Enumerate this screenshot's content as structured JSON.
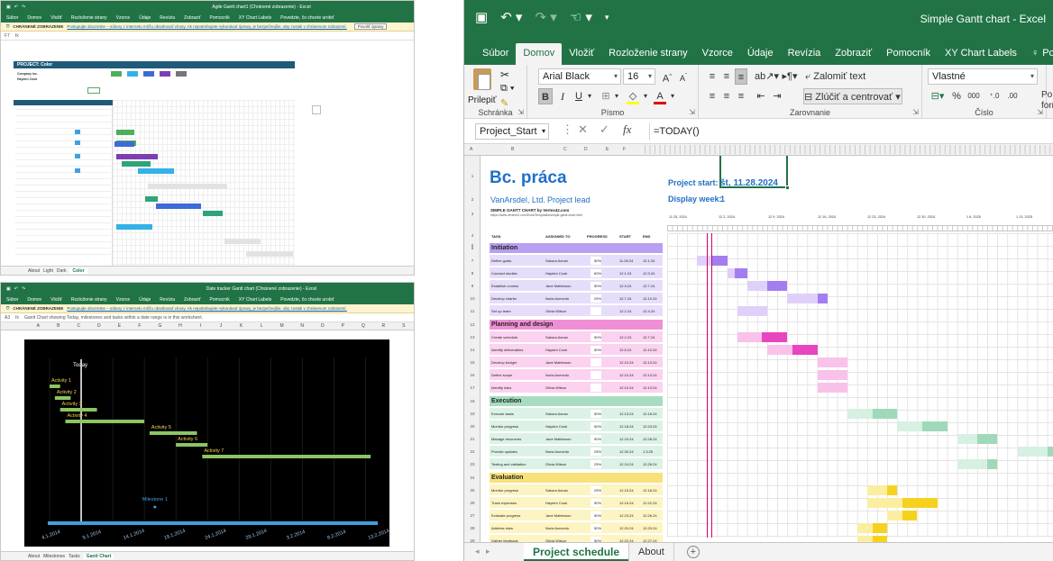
{
  "left_top": {
    "title": "Agile Gantt chart1 (Chránené zobrazenie) - Excel",
    "menu": [
      "Súbor",
      "Domov",
      "Vložiť",
      "Rozloženie strany",
      "Vzorce",
      "Údaje",
      "Revízia",
      "Zobraziť",
      "Pomocník",
      "XY Chart Labels",
      "Povedzte, čo chcete urobiť"
    ],
    "warning_title": "CHRÁNENÉ ZOBRAZENIE",
    "warning_text": "Postupujte obozretne – súbory z internetu môžu obsahovať vírusy. Ak nepotrebujete vykonávať úpravy, je bezpečnejšie, aby zostali v chránenom zobrazení.",
    "warning_button": "Povoliť úpravy",
    "cell_ref": "F7",
    "header": "PROJECT: Color",
    "sub1": "Company Inc.",
    "sub2": "Hayden Cook",
    "tabs": [
      "About",
      "Light",
      "Dark",
      "Color"
    ],
    "active_tab": "Color"
  },
  "left_bottom": {
    "title": "Date tracker Gantt chart (Chránené zobrazenie) - Excel",
    "menu": [
      "Súbor",
      "Domov",
      "Vložiť",
      "Rozloženie strany",
      "Vzorce",
      "Údaje",
      "Revízia",
      "Zobraziť",
      "Pomocník",
      "XY Chart Labels",
      "Povedzte, čo chcete urobiť"
    ],
    "warning_title": "CHRÁNENÉ ZOBRAZENIE",
    "warning_text": "Postupujte obozretne – súbory z internetu môžu obsahovať vírusy. Ak nepotrebujete vykonávať úpravy, je bezpečnejšie, aby zostali v chránenom zobrazení.",
    "cell_ref": "A3",
    "formula": "Gantt Chart showing Today, milestones and tasks within a date range is in this worksheet.",
    "cols": [
      "A",
      "B",
      "C",
      "D",
      "E",
      "F",
      "G",
      "H",
      "I",
      "J",
      "K",
      "L",
      "M",
      "N",
      "O",
      "P",
      "Q",
      "R",
      "S"
    ],
    "tabs": [
      "About",
      "Milestones",
      "Tasks",
      "Gantt Chart"
    ],
    "active_tab": "Gantt Chart",
    "chart": {
      "today_label": "Today",
      "activities": [
        {
          "name": "Activity 1",
          "start": 0,
          "end": 2
        },
        {
          "name": "Activity 2",
          "start": 1,
          "end": 4
        },
        {
          "name": "Activity 3",
          "start": 2,
          "end": 9
        },
        {
          "name": "Activity 4",
          "start": 3,
          "end": 18
        },
        {
          "name": "Activity 5",
          "start": 19,
          "end": 28
        },
        {
          "name": "Activity 6",
          "start": 24,
          "end": 30
        },
        {
          "name": "Activity 7",
          "start": 29,
          "end": 61
        }
      ],
      "milestone": {
        "name": "Milestone 1",
        "day": 20
      },
      "today_day": 6,
      "axis_days": 62,
      "dates": [
        "4.1.2014",
        "9.1.2014",
        "14.1.2014",
        "19.1.2014",
        "24.1.2014",
        "29.1.2014",
        "3.2.2014",
        "8.2.2014",
        "13.2.2014"
      ]
    }
  },
  "main": {
    "title": "Simple Gantt chart - Excel",
    "menu": [
      "Súbor",
      "Domov",
      "Vložiť",
      "Rozloženie strany",
      "Vzorce",
      "Údaje",
      "Revízia",
      "Zobraziť",
      "Pomocník",
      "XY Chart Labels"
    ],
    "active_menu": "Domov",
    "tell_me": "Povedzte, čo chcete",
    "ribbon": {
      "paste": "Prilepiť",
      "clipboard": "Schránka",
      "font_name": "Arial Black",
      "font_size": "16",
      "font_group": "Písmo",
      "wrap_text": "Zalomiť text",
      "merge_center": "Zlúčiť a centrovať",
      "alignment_group": "Zarovnanie",
      "number_format": "Vlastné",
      "number_group": "Číslo",
      "percent": "%",
      "thousands": "000",
      "cond_format_short": "Po form",
      "bold": "B",
      "italic": "I",
      "underline": "U",
      "font_color_letter": "A"
    },
    "name_box": "Project_Start",
    "formula": "=TODAY()",
    "col_letters": [
      "A",
      "B",
      "C",
      "D",
      "E",
      "F"
    ],
    "sheet": {
      "title": "Bc. práca",
      "company": "VanArsdel, Ltd.",
      "lead": "Project lead",
      "project_start_label": "Project start:",
      "project_start_value": "št, 11.28.2024",
      "display_week_label": "Display week:",
      "display_week_value": "1",
      "note": "SIMPLE GANTT CHART by Vertex42.com",
      "note_url": "https://www.vertex42.com/ExcelTemplates/simple-gantt-chart.html",
      "week_dates": [
        "11 25, 2024",
        "12 2, 2024",
        "12 9, 2024",
        "12 16, 2024",
        "12 23, 2024",
        "12 30, 2024",
        "1 6, 2025",
        "1 13, 2025"
      ],
      "table_headers": {
        "task": "TASK",
        "assigned": "ASSIGNED TO",
        "progress": "PROGRESS",
        "start": "START",
        "end": "END"
      },
      "sections": [
        {
          "name": "Initiation",
          "head_color": "#b89ff2",
          "row_color": "#e6ddfb",
          "bar_color": "#a37ef0",
          "bar_light": "#dfd0fa",
          "tasks": [
            {
              "task": "Define goals",
              "who": "Sakura Aznan",
              "progress": "50%",
              "start": "11.28.24",
              "end": "12.1.24",
              "s": 3,
              "e": 6,
              "done": 1.5
            },
            {
              "task": "Conduct studies",
              "who": "Hayden Cook",
              "progress": "60%",
              "start": "12.1.24",
              "end": "12.3.24",
              "s": 6,
              "e": 8,
              "done": 1.2
            },
            {
              "task": "Establish comms",
              "who": "Jane Mattenson",
              "progress": "50%",
              "start": "12.3.24",
              "end": "12.7.24",
              "s": 8,
              "e": 12,
              "done": 2
            },
            {
              "task": "Develop charter",
              "who": "Nuria Acevedo",
              "progress": "25%",
              "start": "12.7.24",
              "end": "12.10.24",
              "s": 12,
              "e": 16,
              "done": 1
            },
            {
              "task": "Set up team",
              "who": "Olivia Wilson",
              "progress": "",
              "start": "12.2.24",
              "end": "12.4.24",
              "s": 7,
              "e": 10,
              "done": 0
            }
          ]
        },
        {
          "name": "Planning and design",
          "head_color": "#f08fd6",
          "row_color": "#fbd2f0",
          "bar_color": "#e845c0",
          "bar_light": "#f8c2ea",
          "tasks": [
            {
              "task": "Create schedule",
              "who": "Sakura Aznan",
              "progress": "50%",
              "start": "12.2.24",
              "end": "12.7.24",
              "s": 7,
              "e": 12,
              "done": 2.5
            },
            {
              "task": "Identify deliverables",
              "who": "Hayden Cook",
              "progress": "50%",
              "start": "12.5.24",
              "end": "12.10.24",
              "s": 10,
              "e": 15,
              "done": 2.5
            },
            {
              "task": "Develop budget",
              "who": "Jane Mattenson",
              "progress": "",
              "start": "12.10.24",
              "end": "12.13.24",
              "s": 15,
              "e": 18,
              "done": 0
            },
            {
              "task": "Define scope",
              "who": "Nuria Acevedo",
              "progress": "",
              "start": "12.10.24",
              "end": "12.13.24",
              "s": 15,
              "e": 18,
              "done": 0
            },
            {
              "task": "Identify risks",
              "who": "Olivia Wilson",
              "progress": "",
              "start": "12.10.24",
              "end": "12.13.24",
              "s": 15,
              "e": 18,
              "done": 0
            }
          ]
        },
        {
          "name": "Execution",
          "head_color": "#a7dcc0",
          "row_color": "#dcf2e6",
          "bar_color": "#9fd9b9",
          "bar_light": "#d6f0e2",
          "tasks": [
            {
              "task": "Execute tasks",
              "who": "Sakura Aznan",
              "progress": "50%",
              "start": "12.13.24",
              "end": "12.18.24",
              "s": 18,
              "e": 23,
              "done": 2.5
            },
            {
              "task": "Monitor progress",
              "who": "Hayden Cook",
              "progress": "50%",
              "start": "12.18.24",
              "end": "12.23.24",
              "s": 23,
              "e": 28,
              "done": 2.5
            },
            {
              "task": "Manage resources",
              "who": "Jane Mattenson",
              "progress": "50%",
              "start": "12.24.24",
              "end": "12.28.24",
              "s": 29,
              "e": 33,
              "done": 2
            },
            {
              "task": "Provide updates",
              "who": "Nuria Acevedo",
              "progress": "25%",
              "start": "12.30.24",
              "end": "1.3.25",
              "s": 35,
              "e": 39,
              "done": 1
            },
            {
              "task": "Testing and validation",
              "who": "Olivia Wilson",
              "progress": "25%",
              "start": "12.24.24",
              "end": "12.28.24",
              "s": 29,
              "e": 33,
              "done": 1
            }
          ]
        },
        {
          "name": "Evaluation",
          "head_color": "#f7e27a",
          "row_color": "#fdf4c3",
          "bar_color": "#f6d21e",
          "bar_light": "#fbeea0",
          "tasks": [
            {
              "task": "Monitor progress",
              "who": "Sakura Aznan",
              "progress": "25%",
              "start": "12.15.24",
              "end": "12.18.24",
              "s": 20,
              "e": 23,
              "done": 1
            },
            {
              "task": "Track expenses",
              "who": "Hayden Cook",
              "progress": "50%",
              "start": "12.15.24",
              "end": "12.22.24",
              "s": 20,
              "e": 27,
              "done": 3.5
            },
            {
              "task": "Evaluate progress",
              "who": "Jane Mattenson",
              "progress": "50%",
              "start": "12.23.24",
              "end": "12.26.24",
              "s": 22,
              "e": 25,
              "done": 1.5
            },
            {
              "task": "Address risks",
              "who": "Nuria Acevedo",
              "progress": "50%",
              "start": "12.20.24",
              "end": "12.23.24",
              "s": 19,
              "e": 22,
              "done": 1.5
            },
            {
              "task": "Gather feedback",
              "who": "Olivia Wilson",
              "progress": "50%",
              "start": "12.22.24",
              "end": "12.27.24",
              "s": 19,
              "e": 22,
              "done": 1.5
            }
          ]
        }
      ],
      "today_day": 4
    },
    "tabs": [
      "Project schedule",
      "About"
    ],
    "active_tab": "Project schedule",
    "add_sheet": "+"
  }
}
